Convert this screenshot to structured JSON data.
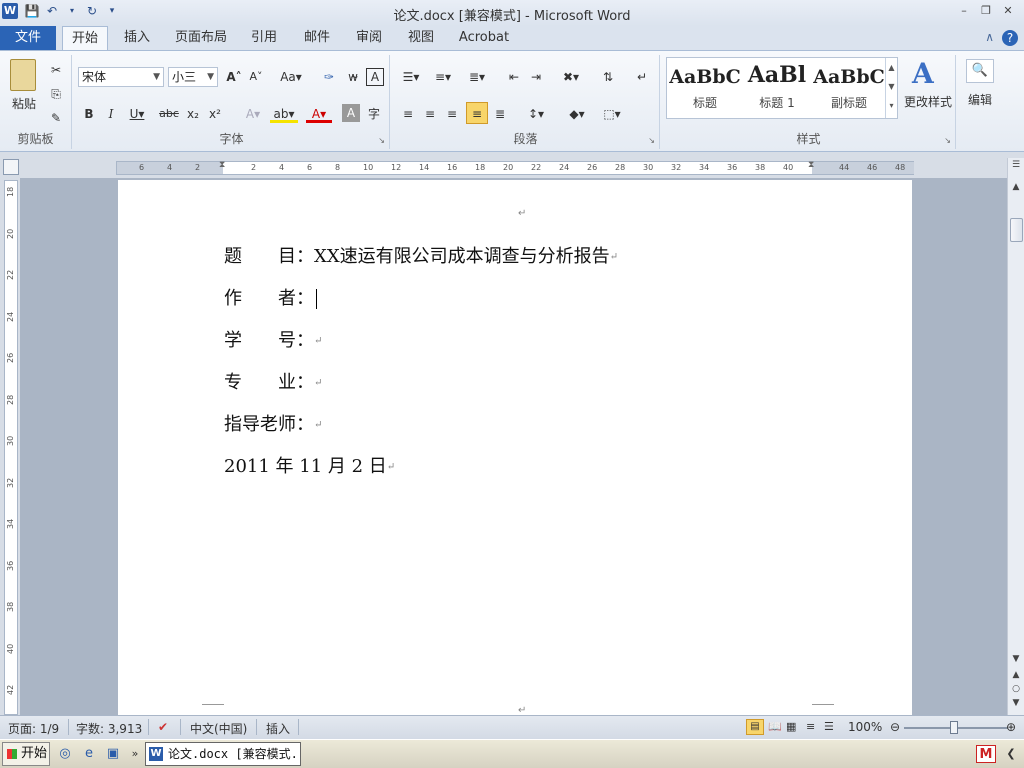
{
  "window": {
    "title": "论文.docx [兼容模式] - Microsoft Word",
    "controls": [
      "minimize-icon",
      "restore-icon",
      "close-icon"
    ]
  },
  "tabs": [
    {
      "label": "文件"
    },
    {
      "label": "开始"
    },
    {
      "label": "插入"
    },
    {
      "label": "页面布局"
    },
    {
      "label": "引用"
    },
    {
      "label": "邮件"
    },
    {
      "label": "审阅"
    },
    {
      "label": "视图"
    },
    {
      "label": "Acrobat"
    }
  ],
  "ribbon": {
    "clipboard": {
      "paste": "粘贴",
      "label": "剪贴板"
    },
    "font": {
      "name": "宋体",
      "size": "小三",
      "label": "字体"
    },
    "paragraph": {
      "label": "段落"
    },
    "styles": {
      "label": "样式",
      "items": [
        {
          "preview": "AaBbC",
          "name": "标题"
        },
        {
          "preview": "AaBl",
          "name": "标题 1"
        },
        {
          "preview": "AaBbC",
          "name": "副标题"
        }
      ],
      "change": "更改样式"
    },
    "editing": {
      "label": "编辑"
    }
  },
  "ruler": {
    "ticks": [
      "6",
      "4",
      "2",
      "2",
      "4",
      "6",
      "8",
      "10",
      "12",
      "14",
      "16",
      "18",
      "20",
      "22",
      "24",
      "26",
      "28",
      "30",
      "32",
      "34",
      "36",
      "38",
      "40",
      "44",
      "46",
      "48"
    ],
    "vticks": [
      "18",
      "20",
      "22",
      "24",
      "26",
      "28",
      "30",
      "32",
      "34",
      "36",
      "38",
      "40",
      "42"
    ]
  },
  "document": {
    "lines": [
      {
        "label": "题　　目：",
        "value": "XX速运有限公司成本调查与分析报告"
      },
      {
        "label": "作　　者：",
        "value": ""
      },
      {
        "label": "学　　号：",
        "value": ""
      },
      {
        "label": "专　　业：",
        "value": ""
      },
      {
        "label": "指导老师：",
        "value": ""
      },
      {
        "label": "",
        "value": "2011 年 11 月 2 日"
      }
    ],
    "para_mark": "↵"
  },
  "status": {
    "page": "页面: 1/9",
    "words": "字数: 3,913",
    "language": "中文(中国)",
    "mode": "插入",
    "zoom": "100%"
  },
  "taskbar": {
    "start": "开始",
    "task": "论文.docx [兼容模式..."
  }
}
